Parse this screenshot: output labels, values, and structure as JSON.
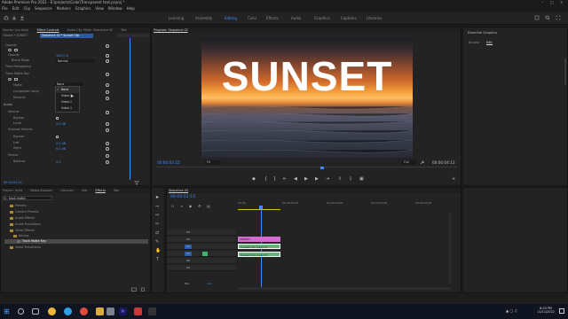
{
  "app": {
    "title": "Adobe Premiere Pro 2021 - E:\\projects\\Color\\Transparent text.prproj *",
    "menus": [
      "File",
      "Edit",
      "Clip",
      "Sequence",
      "Markers",
      "Graphics",
      "View",
      "Window",
      "Help"
    ]
  },
  "workspaces": [
    "Learning",
    "Assembly",
    "Editing",
    "Color",
    "Effects",
    "Audio",
    "Graphics",
    "Captions",
    "Libraries"
  ],
  "active_workspace": "Editing",
  "effect_controls": {
    "tabs": [
      "Source: (no clips)",
      "Effect Controls",
      "Audio Clip Mixer: Sequence 02",
      "Met"
    ],
    "clip_path": "Master * SUNSET",
    "seq_path": "Sequence 02 * Sunset Clip",
    "rows": [
      {
        "label": "Opacity",
        "value": ""
      },
      {
        "label": "Opacity",
        "value": "100.0 %"
      },
      {
        "label": "Blend Mode",
        "value": "Normal"
      },
      {
        "label": "Time Remapping",
        "value": ""
      },
      {
        "label": "Track Matte Key",
        "value": ""
      },
      {
        "label": "Matte",
        "value": "None"
      },
      {
        "label": "Composite Using",
        "value": ""
      },
      {
        "label": "Reverse",
        "value": ""
      },
      {
        "label": "Audio",
        "value": ""
      },
      {
        "label": "Volume",
        "value": ""
      },
      {
        "label": "Bypass",
        "value": ""
      },
      {
        "label": "Level",
        "value": "0.0 dB"
      },
      {
        "label": "Channel Volume",
        "value": ""
      },
      {
        "label": "Bypass",
        "value": ""
      },
      {
        "label": "Left",
        "value": "0.0 dB"
      },
      {
        "label": "Right",
        "value": "0.0 dB"
      },
      {
        "label": "Panner",
        "value": ""
      },
      {
        "label": "Balance",
        "value": "0.0"
      }
    ],
    "dropdown": [
      "None",
      "Video 3",
      "Video 2",
      "Video 1"
    ],
    "timecode": "00:00:02:15"
  },
  "program_monitor": {
    "tab": "Program: Sequence 02",
    "overlay_text": "SUNSET",
    "timecode": "00:00:02:15",
    "fit": "Fit",
    "quality": "Full",
    "duration": "00:00:04:13"
  },
  "essential_graphics": {
    "title": "Essential Graphics",
    "tabs": [
      "Browse",
      "Edit"
    ]
  },
  "effects_panel": {
    "tabs": [
      "Project: Untit",
      "Media Browser",
      "Libraries",
      "Info",
      "Effects",
      "Mar"
    ],
    "search": "track matte",
    "tree": [
      "Presets",
      "Lumetri Presets",
      "Audio Effects",
      "Audio Transitions",
      "Video Effects",
      "Keying",
      "Track Matte Key",
      "Video Transitions"
    ]
  },
  "timeline": {
    "tab": "Sequence 02",
    "timecode": "00:00:02:15",
    "ruler": [
      "00:00",
      "00:00:05:00",
      "00:00:10:00",
      "00:00:15:00",
      "00:00:20:00"
    ],
    "tracks": [
      "V3",
      "V2",
      "V1",
      "A1",
      "A2",
      "A3"
    ],
    "mix": "Mix",
    "mix_value": "0.0",
    "clips": [
      {
        "name": "SUNSET",
        "color": "#d36bd3"
      },
      {
        "name": "Sunset Clip.mp4 [V]",
        "color": "#64b47a"
      },
      {
        "name": "Sunset Clip.mp4 [V]",
        "color": "#64b47a"
      }
    ]
  },
  "taskbar": {
    "time": "8:03 PM",
    "date": "11/11/2022"
  }
}
